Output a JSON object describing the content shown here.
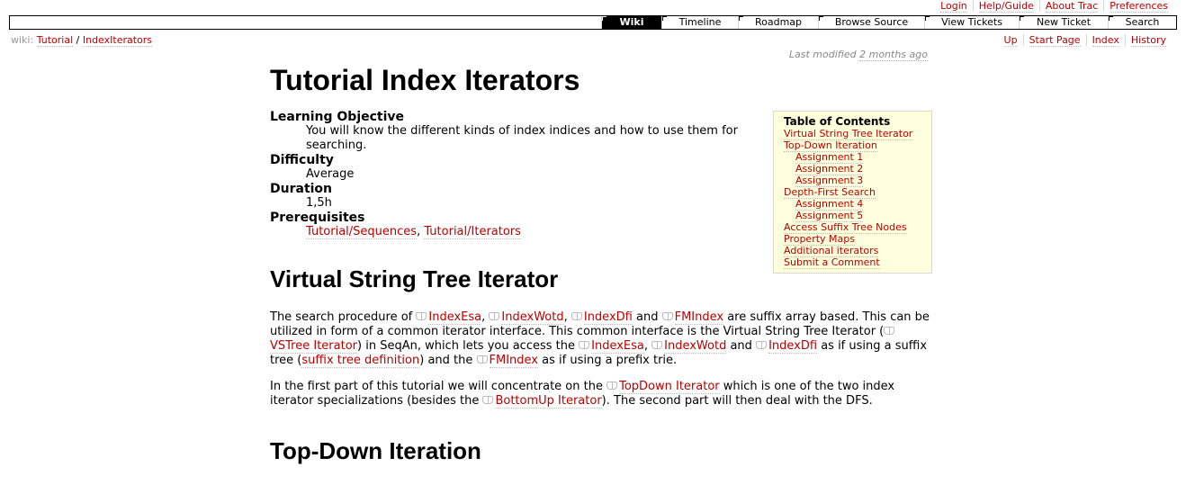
{
  "metanav": [
    "Login",
    "Help/Guide",
    "About Trac",
    "Preferences"
  ],
  "mainnav": [
    {
      "label": "Wiki",
      "active": true,
      "width": 66
    },
    {
      "label": "Timeline",
      "active": false,
      "width": 84
    },
    {
      "label": "Roadmap",
      "active": false,
      "width": 88
    },
    {
      "label": "Browse Source",
      "active": false,
      "width": 117
    },
    {
      "label": "View Tickets",
      "active": false,
      "width": 104
    },
    {
      "label": "New Ticket",
      "active": false,
      "width": 98
    },
    {
      "label": "Search",
      "active": false,
      "width": 75
    }
  ],
  "breadcrumb": {
    "prefix": "wiki:",
    "parts": [
      "Tutorial",
      "IndexIterators"
    ],
    "sep": "/"
  },
  "ctxtnav": [
    "Up",
    "Start Page",
    "Index",
    "History"
  ],
  "last_modified": {
    "prefix": "Last modified",
    "when": "2 months ago"
  },
  "page": {
    "title": "Tutorial Index Iterators",
    "objective_label": "Learning Objective",
    "objective_text": "You will know the different kinds of index indices and how to use them for searching.",
    "difficulty_label": "Difficulty",
    "difficulty_text": "Average",
    "duration_label": "Duration",
    "duration_text": "1,5h",
    "prereq_label": "Prerequisites",
    "prereq_links": [
      "Tutorial/Sequences",
      "Tutorial/Iterators"
    ],
    "prereq_sep": ", "
  },
  "toc": {
    "title": "Table of Contents",
    "items": [
      {
        "label": "Virtual String Tree Iterator",
        "level": 1
      },
      {
        "label": "Top-Down Iteration",
        "level": 1
      },
      {
        "label": "Assignment 1",
        "level": 2
      },
      {
        "label": "Assignment 2",
        "level": 2
      },
      {
        "label": "Assignment 3",
        "level": 2
      },
      {
        "label": "Depth-First Search",
        "level": 1
      },
      {
        "label": "Assignment 4",
        "level": 2
      },
      {
        "label": "Assignment 5",
        "level": 2
      },
      {
        "label": "Access Suffix Tree Nodes",
        "level": 1
      },
      {
        "label": "Property Maps",
        "level": 1
      },
      {
        "label": "Additional iterators",
        "level": 1
      },
      {
        "label": "Submit a Comment",
        "level": 1
      }
    ]
  },
  "section1": {
    "heading": "Virtual String Tree Iterator",
    "para1": [
      {
        "t": "The search procedure of "
      },
      {
        "link": "IndexEsa",
        "icon": true
      },
      {
        "t": ", "
      },
      {
        "link": "IndexWotd",
        "icon": true
      },
      {
        "t": ", "
      },
      {
        "link": "IndexDfi",
        "icon": true
      },
      {
        "t": " and "
      },
      {
        "link": "FMIndex",
        "icon": true
      },
      {
        "t": " are suffix array based. This can be utilized in form of a common iterator interface. This common interface is the Virtual String Tree Iterator ("
      },
      {
        "link": "VSTree Iterator",
        "icon": true
      },
      {
        "t": ") in SeqAn, which lets you access the "
      },
      {
        "link": "IndexEsa",
        "icon": true
      },
      {
        "t": ", "
      },
      {
        "link": "IndexWotd",
        "icon": true
      },
      {
        "t": " and "
      },
      {
        "link": "IndexDfi",
        "icon": true
      },
      {
        "t": " as if using a suffix tree ("
      },
      {
        "link": "suffix tree definition",
        "icon": false
      },
      {
        "t": ") and the "
      },
      {
        "link": "FMIndex",
        "icon": true
      },
      {
        "t": " as if using a prefix trie."
      }
    ],
    "para2": [
      {
        "t": "In the first part of this tutorial we will concentrate on the "
      },
      {
        "link": "TopDown Iterator",
        "icon": true
      },
      {
        "t": " which is one of the two index iterator specializations (besides the "
      },
      {
        "link": "BottomUp Iterator",
        "icon": true
      },
      {
        "t": "). The second part will then deal with the DFS."
      }
    ]
  },
  "section2": {
    "heading": "Top-Down Iteration"
  }
}
